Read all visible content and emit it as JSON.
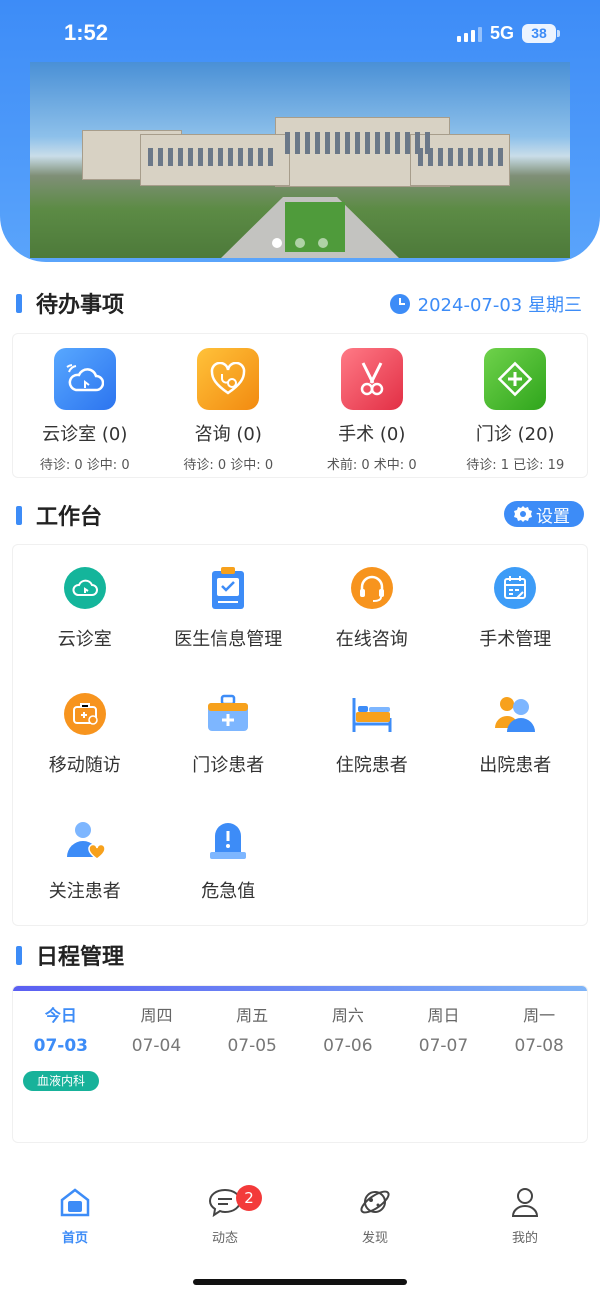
{
  "status": {
    "time": "1:52",
    "network": "5G",
    "battery": "38"
  },
  "banner": {
    "dots": 3,
    "active_dot": 0
  },
  "todo": {
    "title": "待办事项",
    "date": "2024-07-03 星期三",
    "items": [
      {
        "name": "云诊室 (0)",
        "sub": "待诊: 0 诊中: 0",
        "icon": "cloud-clinic-icon",
        "color": "#3d8cf7"
      },
      {
        "name": "咨询 (0)",
        "sub": "待诊: 0 诊中: 0",
        "icon": "consult-heart-icon",
        "color": "#f7a11c"
      },
      {
        "name": "手术 (0)",
        "sub": "术前: 0 术中: 0",
        "icon": "surgery-scissors-icon",
        "color": "#ef4d5c"
      },
      {
        "name": "门诊 (20)",
        "sub": "待诊: 1 已诊: 19",
        "icon": "outpatient-cross-icon",
        "color": "#3fb526"
      }
    ]
  },
  "workbench": {
    "title": "工作台",
    "settings_label": "设置",
    "items": [
      {
        "label": "云诊室",
        "icon": "cloud-clinic-icon"
      },
      {
        "label": "医生信息管理",
        "icon": "clipboard-check-icon"
      },
      {
        "label": "在线咨询",
        "icon": "headset-icon"
      },
      {
        "label": "手术管理",
        "icon": "calendar-icon"
      },
      {
        "label": "移动随访",
        "icon": "medical-bag-icon"
      },
      {
        "label": "门诊患者",
        "icon": "first-aid-kit-icon"
      },
      {
        "label": "住院患者",
        "icon": "hospital-bed-icon"
      },
      {
        "label": "出院患者",
        "icon": "patients-icon"
      },
      {
        "label": "关注患者",
        "icon": "patient-heart-icon"
      },
      {
        "label": "危急值",
        "icon": "alert-siren-icon"
      }
    ]
  },
  "schedule": {
    "title": "日程管理",
    "days": [
      {
        "week": "今日",
        "date": "07-03",
        "today": true
      },
      {
        "week": "周四",
        "date": "07-04"
      },
      {
        "week": "周五",
        "date": "07-05"
      },
      {
        "week": "周六",
        "date": "07-06"
      },
      {
        "week": "周日",
        "date": "07-07"
      },
      {
        "week": "周一",
        "date": "07-08"
      }
    ],
    "tag": "血液内科"
  },
  "tabbar": {
    "tabs": [
      {
        "label": "首页",
        "icon": "home-icon",
        "active": true
      },
      {
        "label": "动态",
        "icon": "chat-icon",
        "badge": "2"
      },
      {
        "label": "发现",
        "icon": "planet-icon"
      },
      {
        "label": "我的",
        "icon": "user-icon"
      }
    ]
  }
}
